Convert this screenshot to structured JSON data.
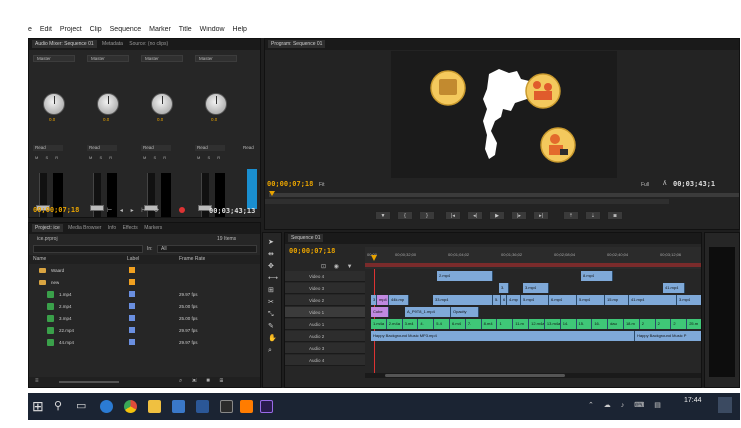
{
  "menubar": [
    "e",
    "Edit",
    "Project",
    "Clip",
    "Sequence",
    "Marker",
    "Title",
    "Window",
    "Help"
  ],
  "audio_mixer": {
    "tabs": [
      "Audio Mixer: Sequence 01",
      "Metadata",
      "Source: (no clips)"
    ],
    "channels": [
      {
        "track": "Master",
        "value": "0.0",
        "read": "Read"
      },
      {
        "track": "Master",
        "value": "0.0",
        "read": "Read"
      },
      {
        "track": "Master",
        "value": "0.0",
        "read": "Read"
      },
      {
        "track": "Master",
        "value": "0.0",
        "read": "Read"
      }
    ],
    "read_extra": "Read",
    "timecode": "00;00;07;18",
    "duration": "00;03;43;13"
  },
  "program": {
    "tab": "Program: Sequence 01",
    "timecode": "00;00;07;18",
    "fit": "Fit",
    "full": "Full",
    "duration": "00;03;43;1"
  },
  "project": {
    "tabs": [
      "Project: ice",
      "Media Browser",
      "Info",
      "Effects",
      "Markers"
    ],
    "project_name": "ice.prproj",
    "items_count": "19 Items",
    "in_label": "In:",
    "in_value": "All",
    "columns": [
      "Name",
      "Label",
      "Frame Rate"
    ],
    "rows": [
      {
        "name": "Waard",
        "type": "folder",
        "label_color": "#f0a020",
        "fps": ""
      },
      {
        "name": "new",
        "type": "folder",
        "label_color": "#f0a020",
        "fps": ""
      },
      {
        "name": "1.mp4",
        "type": "clip",
        "label_color": "#6a8fe0",
        "fps": "29.97 fps"
      },
      {
        "name": "2.mp4",
        "type": "clip",
        "label_color": "#6a8fe0",
        "fps": "25.00 fps"
      },
      {
        "name": "3.mp4",
        "type": "clip",
        "label_color": "#6a8fe0",
        "fps": "25.00 fps"
      },
      {
        "name": "22.mp4",
        "type": "clip",
        "label_color": "#6a8fe0",
        "fps": "29.97 fps"
      },
      {
        "name": "44.mp4",
        "type": "clip",
        "label_color": "#6a8fe0",
        "fps": "29.97 fps"
      }
    ]
  },
  "timeline": {
    "tab": "Sequence 01",
    "timecode": "00;00;07;18",
    "ruler": [
      "00;00",
      "00;00;32;00",
      "00;01;04;02",
      "00;01;36;02",
      "00;02;08;04",
      "00;02;40;04",
      "00;03;12;06"
    ],
    "tracks": [
      "Video 4",
      "Video 3",
      "Video 2",
      "Video 1",
      "Audio 1",
      "Audio 2",
      "Audio 3",
      "Audio 4"
    ],
    "clips": {
      "v4": [
        "2.mp4",
        "8.mp4"
      ],
      "v3": [
        "3.",
        "3.mp4",
        "41.mp4"
      ],
      "v2": [
        "3",
        "mp4",
        "44k.mp",
        "33.mp4",
        "5.",
        "6",
        "4.mp",
        "5.mp4",
        "6.mp4",
        "5.mp4",
        "15.mp",
        "41.mp4",
        "3.mp4"
      ],
      "v1": [
        "Cube",
        "A_P9T8_1.mp4",
        "Opacity"
      ],
      "a1": [
        "1.m4a",
        "2.m4a",
        "3.m4",
        "4.",
        "5.4",
        "6.m4",
        "7.",
        "8.m4",
        "1",
        "11.m",
        "12.m4a",
        "13.m4a",
        "14.",
        "15.",
        "16.",
        "dau",
        "18.m",
        "2",
        "2",
        "2",
        "25.m"
      ],
      "a2_left": "Happy Background Music MP3.mp4",
      "a2_right": "Happy Background Music P"
    }
  },
  "taskbar": {
    "time": "17:44",
    "icons": [
      "start-icon",
      "search-icon",
      "task-view-icon",
      "edge-icon",
      "chrome-icon",
      "explorer-icon",
      "store-icon",
      "word-icon",
      "mixer-icon",
      "illustrator-icon",
      "premiere-icon"
    ]
  }
}
